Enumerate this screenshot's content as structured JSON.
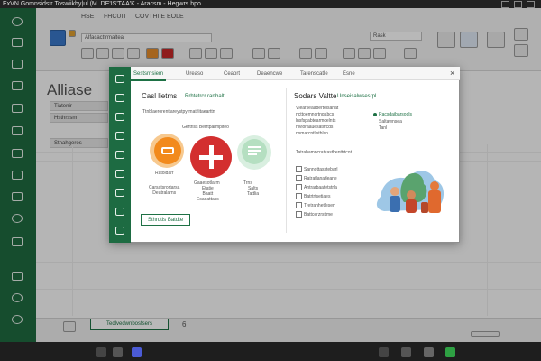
{
  "window": {
    "title": "ExVN Gomnsidstr  Toswiikhy|ul (M. DE'IS'TAA'K - Aracsm - Hegwrs  hpo"
  },
  "ribbon": {
    "tabs": [
      "HSE",
      "FHCUIT",
      "COVTHIIE EOLE"
    ],
    "field_left": "Alfacacttrmaltea",
    "field_right": "Rask"
  },
  "sheet": {
    "title": "Alliase",
    "rows": [
      "Tiatenir",
      "Hsthrssm",
      "Stnahgeros"
    ],
    "tab_label": "Tedlvedwnbosfsers",
    "tab_marker": "6"
  },
  "dialog": {
    "tabs": [
      "Sestsrnsiem",
      "Ureaso",
      "Ceaort",
      "Deaencwe",
      "Tarenscatle",
      "Esne"
    ],
    "close_label": "×",
    "left": {
      "heading": "Casl lietms",
      "link": "Rrhtetrcr rartbalt",
      "subtitle": "Ttnblaerorentlareystpyrmatrlitaearttn",
      "card_label": "Gertriss Berrtparmplteo",
      "items": [
        {
          "title": "Ratoldarr",
          "desc": "Carsatsrortarsa\nDeatralarns"
        },
        {
          "title": "Gaaesotlarm",
          "desc": "Etatie\nBaatt\nEsaoattacs"
        },
        {
          "title": "Trns",
          "desc": "Salts\nTattlia"
        }
      ],
      "action_button": "Sthrdtls Batdte"
    },
    "right": {
      "heading": "Sodars Valtte",
      "link": "Unseisalwsesrpl",
      "desc": [
        "Vlearseaabertelsanat",
        "ncttoemncrtngabcs",
        "lnsfspabtearmcelnts",
        "nlvloraauesatlncds",
        "nsmarcntllstblsn"
      ],
      "promo": [
        "Racsdaibarsodls",
        "Saltawnsea",
        "Tanl"
      ],
      "recent_heading": "Tatrabamncratcasthenttrtcot",
      "recent": [
        "Sannottasstebarl",
        "Ratratlanatleane",
        "Antrarbaatetstrla",
        "Batrtrtsetiaes",
        "Tretranhetlesen",
        "Battcerzrstlme"
      ]
    }
  },
  "colors": {
    "accent": "#1e7145",
    "orange": "#f28a1c",
    "red": "#d32f2f",
    "green_soft": "#b5dfc1"
  },
  "icons": {
    "orange_circle": "document-edit-icon",
    "red_circle": "plus-icon",
    "green_circle": "message-list-icon"
  }
}
